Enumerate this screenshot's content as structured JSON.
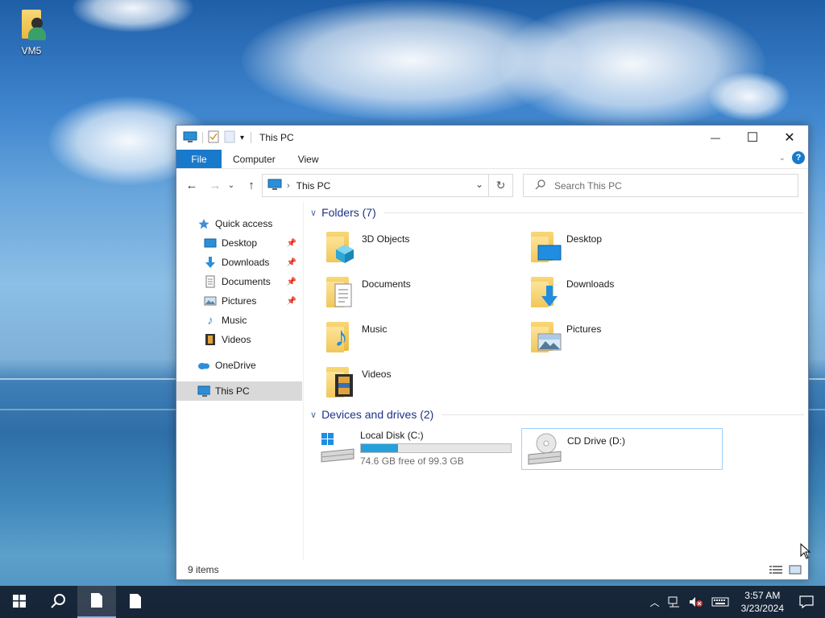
{
  "desktop": {
    "icon_label": "VM5"
  },
  "window": {
    "title": "This PC",
    "controls": {
      "minimize": "—",
      "maximize": "☐",
      "close": "✕"
    }
  },
  "ribbon": {
    "tabs": [
      "File",
      "Computer",
      "View"
    ]
  },
  "address": {
    "crumb": "This PC"
  },
  "search": {
    "placeholder": "Search This PC"
  },
  "nav": {
    "quick_access": "Quick access",
    "items": [
      {
        "label": "Desktop",
        "pinned": true
      },
      {
        "label": "Downloads",
        "pinned": true
      },
      {
        "label": "Documents",
        "pinned": true
      },
      {
        "label": "Pictures",
        "pinned": true
      },
      {
        "label": "Music",
        "pinned": false
      },
      {
        "label": "Videos",
        "pinned": false
      }
    ],
    "onedrive": "OneDrive",
    "this_pc": "This PC"
  },
  "folders": {
    "header": "Folders (7)",
    "items": [
      "3D Objects",
      "Desktop",
      "Documents",
      "Downloads",
      "Music",
      "Pictures",
      "Videos"
    ]
  },
  "drives": {
    "header": "Devices and drives (2)",
    "items": [
      {
        "name": "Local Disk (C:)",
        "free_text": "74.6 GB free of 99.3 GB",
        "used_fraction": 0.249
      },
      {
        "name": "CD Drive (D:)"
      }
    ]
  },
  "status": {
    "items": "9 items"
  },
  "taskbar": {
    "time": "3:57 AM",
    "date": "3/23/2024"
  },
  "colors": {
    "accent": "#1979ca",
    "group_header": "#1e3287",
    "drive_bar": "#26a0da"
  }
}
